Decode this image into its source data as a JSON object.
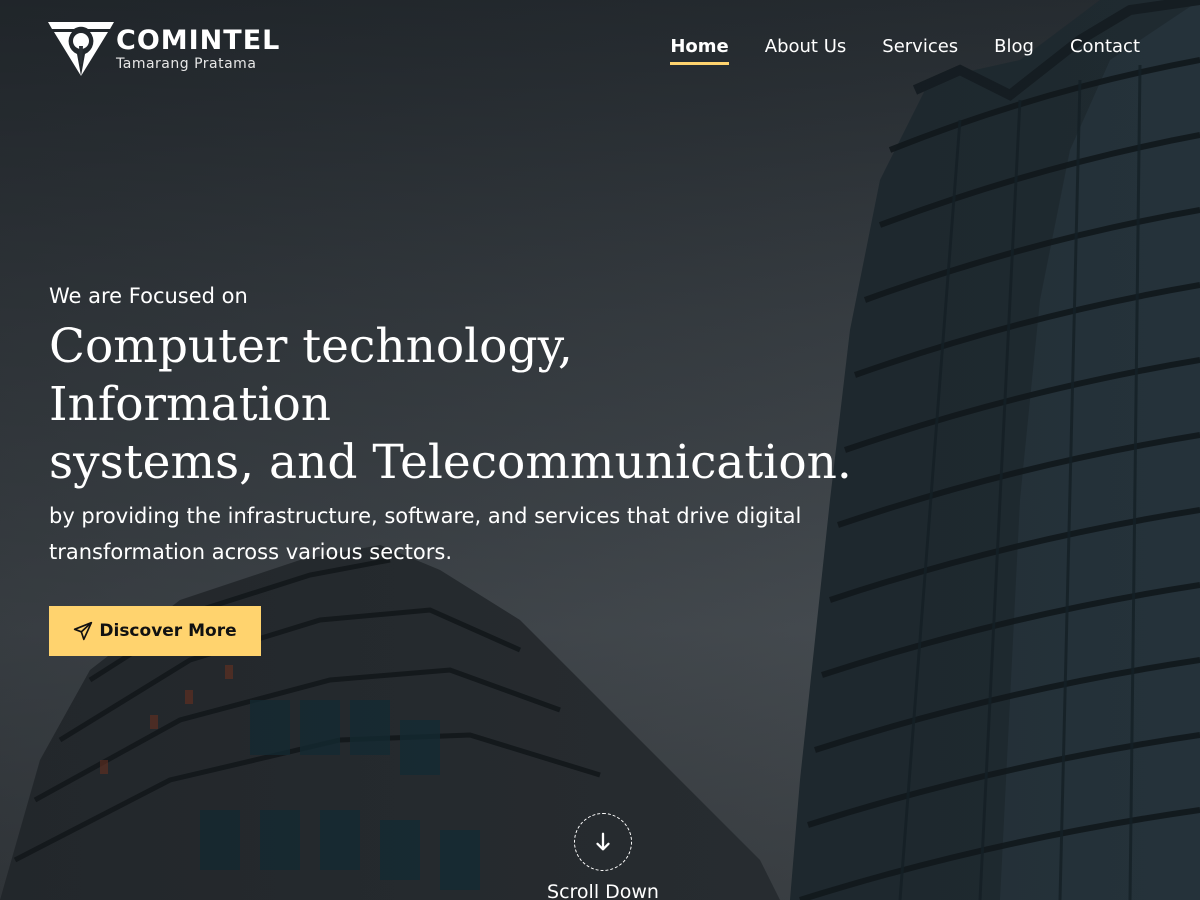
{
  "brand": {
    "name": "COMINTEL",
    "tagline": "Tamarang Pratama",
    "logo_icon": "comintel-logo-icon",
    "accent_color": "#ffd36e"
  },
  "nav": {
    "items": [
      {
        "label": "Home",
        "active": true
      },
      {
        "label": "About Us",
        "active": false
      },
      {
        "label": "Services",
        "active": false
      },
      {
        "label": "Blog",
        "active": false
      },
      {
        "label": "Contact",
        "active": false
      }
    ]
  },
  "hero": {
    "eyebrow": "We are Focused on",
    "headline_line1": "Computer technology, Information",
    "headline_line2": "systems, and Telecommunication.",
    "subtext_line1": "by providing the infrastructure, software, and services that drive digital",
    "subtext_line2": "transformation across various sectors.",
    "cta_label": "Discover More",
    "cta_icon": "paper-plane-icon",
    "background": "dark-office-buildings-photo"
  },
  "scroll": {
    "label": "Scroll Down",
    "icon": "arrow-down-icon"
  }
}
